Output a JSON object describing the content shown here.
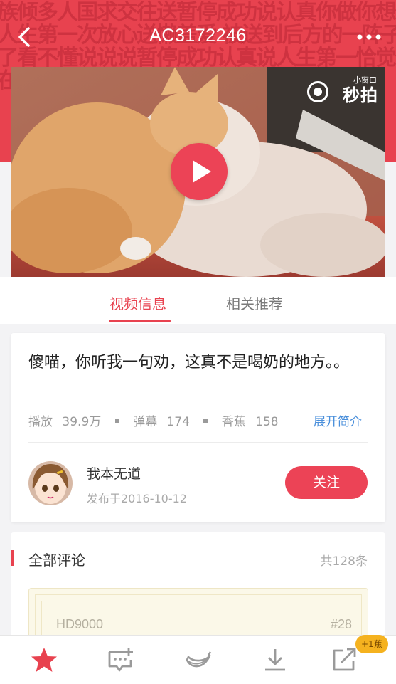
{
  "header": {
    "title": "AC3172246",
    "background_text": "族倾多人国求交往送暂停成功说认真你做你想做人生第一次放心送懒盖爱 被送到后方的一阵子看了看不懂说说说暂停成功认真说人生第一恰觉他在欢我我的 就是要你自己的",
    "accent_color": "#e8424f",
    "icons": {
      "back": "back-arrow-icon",
      "more": "more-dots-icon"
    }
  },
  "video": {
    "watermark_small": "小窗口",
    "watermark_brand": "秒拍",
    "play_icon": "play-icon"
  },
  "tabs": [
    {
      "label": "视频信息",
      "active": true
    },
    {
      "label": "相关推荐",
      "active": false
    }
  ],
  "info": {
    "title": "傻喵，你听我一句劝，这真不是喝奶的地方。。",
    "stats": {
      "play_label": "播放",
      "play_value": "39.9万",
      "danmaku_label": "弹幕",
      "danmaku_value": "174",
      "banana_label": "香蕉",
      "banana_value": "158"
    },
    "expand_label": "展开简介",
    "uploader": {
      "name": "我本无道",
      "date": "发布于2016-10-12",
      "follow_label": "关注"
    }
  },
  "comments": {
    "title": "全部评论",
    "count": "共128条",
    "first": {
      "user": "HD9000",
      "floor": "#28"
    }
  },
  "bottom_bar": {
    "items": [
      "star-icon",
      "comment-add-icon",
      "banana-icon",
      "download-icon",
      "share-icon"
    ],
    "badge": "+1蕉",
    "active_color": "#e8424f",
    "icon_color": "#9a9a9a"
  }
}
